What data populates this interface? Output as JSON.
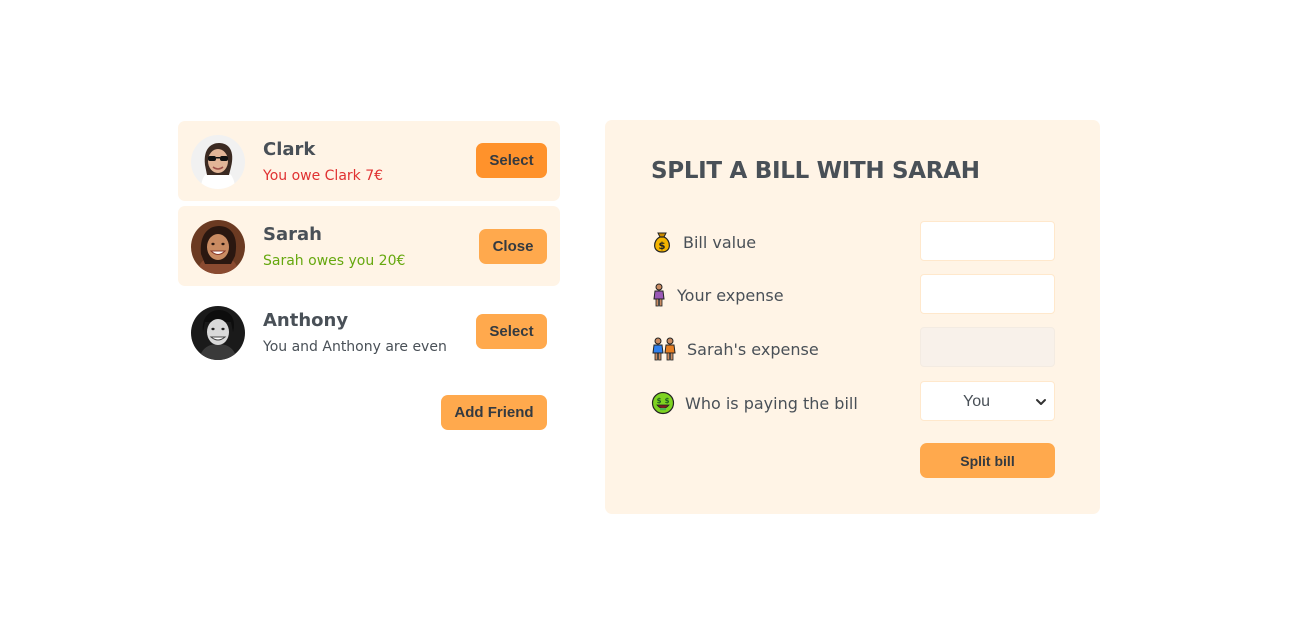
{
  "friends": [
    {
      "name": "Clark",
      "status": "You owe Clark 7€",
      "status_color": "#e03131",
      "button_label": "Select"
    },
    {
      "name": "Sarah",
      "status": "Sarah owes you 20€",
      "status_color": "#66a80f",
      "button_label": "Close"
    },
    {
      "name": "Anthony",
      "status": "You and Anthony are even",
      "status_color": "#495057",
      "button_label": "Select"
    }
  ],
  "add_friend_label": "Add Friend",
  "split_form": {
    "title": "SPLIT A BILL WITH SARAH",
    "bill_value_label": "Bill value",
    "bill_value": "",
    "your_expense_label": "Your expense",
    "your_expense": "",
    "friend_expense_label": "Sarah's expense",
    "friend_expense": "",
    "payer_label": "Who is paying the bill",
    "payer_selected": "You",
    "submit_label": "Split bill"
  },
  "colors": {
    "accent": "#ffa94d",
    "accent_dark": "#ff922b",
    "panel_bg": "#fff4e6",
    "text": "#495057",
    "owe_red": "#e03131",
    "owed_green": "#66a80f"
  },
  "icons": {
    "bill_value": "money-bag-icon",
    "your_expense": "person-icon",
    "friend_expense": "couple-icon",
    "payer": "money-face-icon"
  }
}
